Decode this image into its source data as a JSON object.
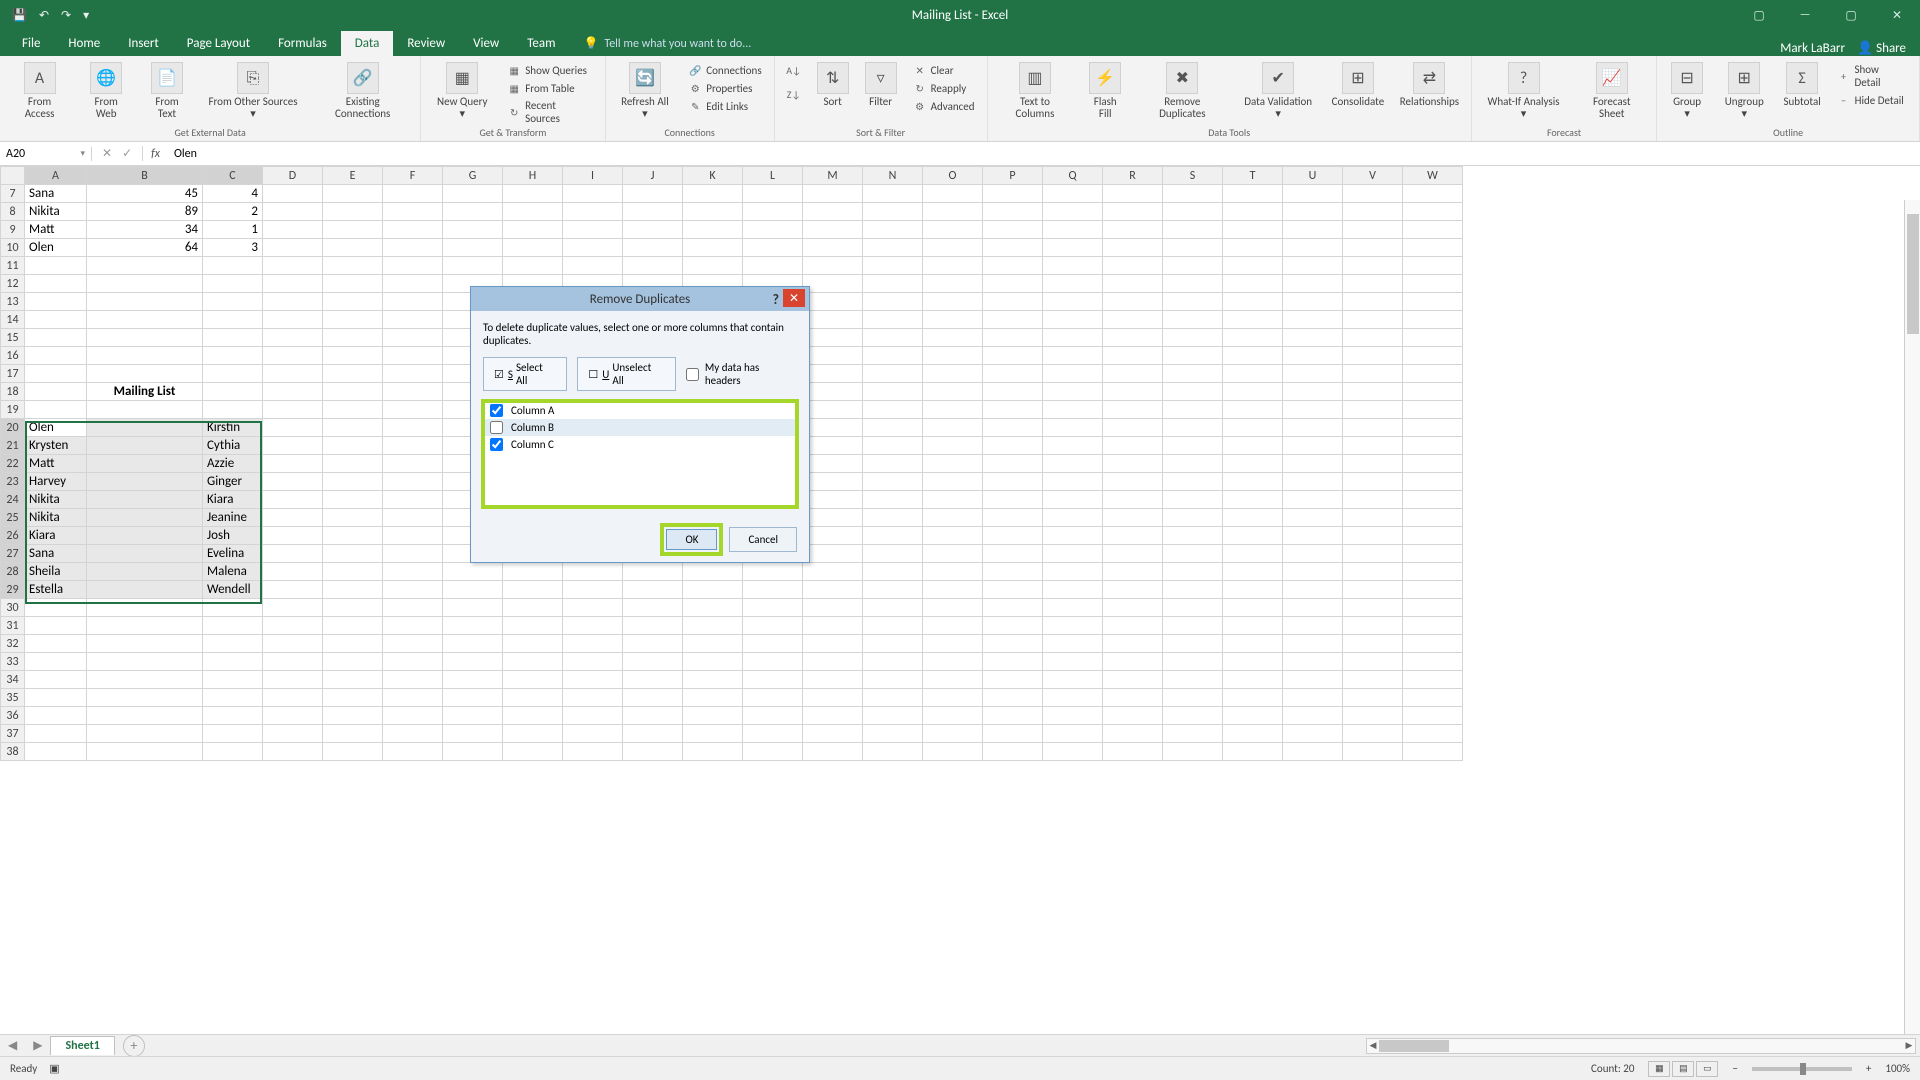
{
  "app": {
    "title": "Mailing List - Excel",
    "user": "Mark LaBarr",
    "share": "Share"
  },
  "qat": {
    "save": "💾",
    "undo": "↶",
    "redo": "↷",
    "more": "▾"
  },
  "win": {
    "opts": "▢",
    "min": "—",
    "max": "▢",
    "close": "✕"
  },
  "tabs": [
    "File",
    "Home",
    "Insert",
    "Page Layout",
    "Formulas",
    "Data",
    "Review",
    "View",
    "Team"
  ],
  "tellme": "Tell me what you want to do...",
  "ribbon": {
    "group1": {
      "label": "Get External Data",
      "btns": [
        "From Access",
        "From Web",
        "From Text",
        "From Other Sources ▾",
        "Existing Connections"
      ]
    },
    "group2": {
      "label": "Get & Transform",
      "main": "New Query ▾",
      "list": [
        "Show Queries",
        "From Table",
        "Recent Sources"
      ]
    },
    "group3": {
      "label": "Connections",
      "main": "Refresh All ▾",
      "list": [
        "Connections",
        "Properties",
        "Edit Links"
      ]
    },
    "group4": {
      "label": "Sort & Filter",
      "btns": [
        "Sort",
        "Filter"
      ],
      "small": [
        "⬆⬇",
        "⬇⬆"
      ],
      "list": [
        "Clear",
        "Reapply",
        "Advanced"
      ]
    },
    "group5": {
      "label": "Data Tools",
      "btns": [
        "Text to Columns",
        "Flash Fill",
        "Remove Duplicates",
        "Data Validation ▾",
        "Consolidate",
        "Relationships"
      ]
    },
    "group6": {
      "label": "Forecast",
      "btns": [
        "What-If Analysis ▾",
        "Forecast Sheet"
      ]
    },
    "group7": {
      "label": "Outline",
      "btns": [
        "Group ▾",
        "Ungroup ▾",
        "Subtotal"
      ],
      "list": [
        "Show Detail",
        "Hide Detail"
      ]
    }
  },
  "fx": {
    "name": "A20",
    "value": "Olen",
    "fxsym": "fx"
  },
  "cols": [
    "A",
    "B",
    "C",
    "D",
    "E",
    "F",
    "G",
    "H",
    "I",
    "J",
    "K",
    "L",
    "M",
    "N",
    "O",
    "P",
    "Q",
    "R",
    "S",
    "T",
    "U",
    "V",
    "W"
  ],
  "rows_start": 7,
  "rows_end": 38,
  "data": {
    "7": {
      "A": "Sana",
      "B": "45",
      "C": "4"
    },
    "8": {
      "A": "Nikita",
      "B": "89",
      "C": "2"
    },
    "9": {
      "A": "Matt",
      "B": "34",
      "C": "1"
    },
    "10": {
      "A": "Olen",
      "B": "64",
      "C": "3"
    },
    "18": {
      "B": "Mailing List"
    },
    "20": {
      "A": "Olen",
      "C": "Kirstin"
    },
    "21": {
      "A": "Krysten",
      "C": "Cythia"
    },
    "22": {
      "A": "Matt",
      "C": "Azzie"
    },
    "23": {
      "A": "Harvey",
      "C": "Ginger"
    },
    "24": {
      "A": "Nikita",
      "C": "Kiara"
    },
    "25": {
      "A": "Nikita",
      "C": "Jeanine"
    },
    "26": {
      "A": "Kiara",
      "C": "Josh"
    },
    "27": {
      "A": "Sana",
      "C": "Evelina"
    },
    "28": {
      "A": "Sheila",
      "C": "Malena"
    },
    "29": {
      "A": "Estella",
      "C": "Wendell"
    }
  },
  "dialog": {
    "title": "Remove Duplicates",
    "desc": "To delete duplicate values, select one or more columns that contain duplicates.",
    "selectAll": "Select All",
    "unselectAll": "Unselect All",
    "headers": "My data has headers",
    "cols": [
      {
        "label": "Column A",
        "checked": true
      },
      {
        "label": "Column B",
        "checked": false
      },
      {
        "label": "Column C",
        "checked": true
      }
    ],
    "ok": "OK",
    "cancel": "Cancel"
  },
  "sheet": {
    "name": "Sheet1"
  },
  "status": {
    "ready": "Ready",
    "count": "Count: 20",
    "zoom": "100%"
  },
  "chart_data": {
    "type": "table",
    "title": "Mailing List worksheet selection (A20:C29)",
    "columns": [
      "A",
      "B",
      "C"
    ],
    "rows": [
      [
        "Olen",
        "",
        "Kirstin"
      ],
      [
        "Krysten",
        "",
        "Cythia"
      ],
      [
        "Matt",
        "",
        "Azzie"
      ],
      [
        "Harvey",
        "",
        "Ginger"
      ],
      [
        "Nikita",
        "",
        "Kiara"
      ],
      [
        "Nikita",
        "",
        "Jeanine"
      ],
      [
        "Kiara",
        "",
        "Josh"
      ],
      [
        "Sana",
        "",
        "Evelina"
      ],
      [
        "Sheila",
        "",
        "Malena"
      ],
      [
        "Estella",
        "",
        "Wendell"
      ]
    ],
    "upper_block": {
      "columns": [
        "A",
        "B",
        "C"
      ],
      "rows": [
        [
          "Sana",
          45,
          4
        ],
        [
          "Nikita",
          89,
          2
        ],
        [
          "Matt",
          34,
          1
        ],
        [
          "Olen",
          64,
          3
        ]
      ]
    }
  }
}
